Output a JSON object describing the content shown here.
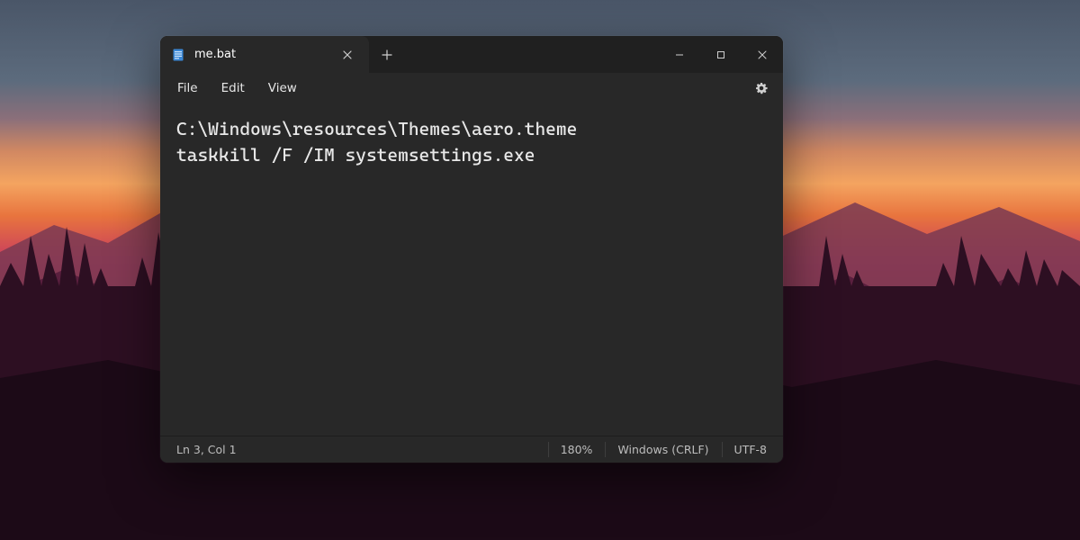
{
  "tab": {
    "title": "me.bat",
    "icon": "notepad-file-icon"
  },
  "menu": {
    "file": "File",
    "edit": "Edit",
    "view": "View"
  },
  "editor": {
    "content": "C:\\Windows\\resources\\Themes\\aero.theme\ntaskkill /F /IM systemsettings.exe"
  },
  "status": {
    "cursor": "Ln 3, Col 1",
    "zoom": "180%",
    "line_endings": "Windows (CRLF)",
    "encoding": "UTF-8"
  },
  "window_controls": {
    "minimize": "minimize",
    "maximize": "maximize",
    "close": "close"
  }
}
